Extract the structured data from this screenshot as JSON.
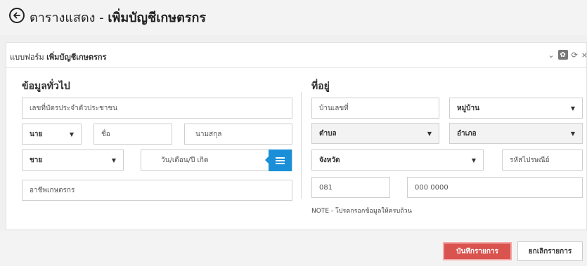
{
  "header": {
    "title_prefix": "ตารางแสดง - ",
    "title_main": "เพิ่มบัญชีเกษตรกร"
  },
  "panel": {
    "title_prefix": "แบบฟอร์ม ",
    "title_main": "เพิ่มบัญชีเกษตรกร",
    "tools": {
      "collapse": "⌄",
      "settings": "✿",
      "refresh": "⟳",
      "close": "×"
    }
  },
  "general": {
    "section_title": "ข้อมูลทั่วไป",
    "id_card_placeholder": "เลขที่บัตรประจำตัวประชาชน",
    "title_value": "นาย",
    "first_name_placeholder": "ชื่อ",
    "last_name_placeholder": "นามสกุล",
    "gender_value": "ชาย",
    "birthdate_placeholder": "วัน/เดือน/ปี เกิด",
    "occupation_value": "อาชีพเกษตรกร"
  },
  "address": {
    "section_title": "ที่อยู่",
    "house_no_placeholder": "บ้านเลขที่",
    "village_value": "หมู่บ้าน",
    "subdistrict_value": "ตำบล",
    "district_value": "อำเภอ",
    "province_value": "จังหวัด",
    "postcode_placeholder": "รหัสไปรษณีย์",
    "phone_prefix": "081",
    "phone_number": "000 0000",
    "note": "NOTE - โปรดกรอกข้อมูลให้ครบถ้วน"
  },
  "footer": {
    "save_label": "บันทึกรายการ",
    "cancel_label": "ยกเลิกรายการ"
  },
  "colors": {
    "save": "#d9534f",
    "calendar": "#1a8fd8"
  }
}
